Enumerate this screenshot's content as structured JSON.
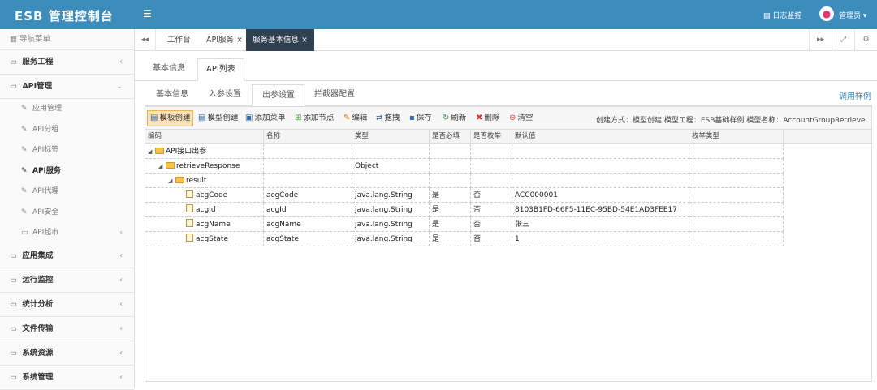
{
  "header": {
    "brand": "ESB 管理控制台",
    "log_link": "日志监控",
    "user": "管理员"
  },
  "sidebar": {
    "nav_title": "导航菜单",
    "menus": [
      {
        "label": "服务工程"
      },
      {
        "label": "API管理",
        "expanded": true
      },
      {
        "label": "应用集成"
      },
      {
        "label": "运行监控"
      },
      {
        "label": "统计分析"
      },
      {
        "label": "文件传输"
      },
      {
        "label": "系统资源"
      },
      {
        "label": "系统管理"
      }
    ],
    "api_items": [
      {
        "label": "应用管理"
      },
      {
        "label": "API分组"
      },
      {
        "label": "API标签"
      },
      {
        "label": "API服务",
        "active": true
      },
      {
        "label": "API代理"
      },
      {
        "label": "API安全"
      },
      {
        "label": "API超市"
      }
    ]
  },
  "page_tabs": [
    {
      "label": "工作台"
    },
    {
      "label": "API服务"
    },
    {
      "label": "服务基本信息",
      "active": true
    }
  ],
  "level1_tabs": [
    {
      "label": "基本信息"
    },
    {
      "label": "API列表",
      "active": true
    }
  ],
  "level2_tabs": [
    {
      "label": "基本信息"
    },
    {
      "label": "入参设置"
    },
    {
      "label": "出参设置",
      "active": true
    },
    {
      "label": "拦截器配置"
    }
  ],
  "side_link": "调用样例",
  "toolbar": {
    "buttons": [
      {
        "label": "模板创建",
        "icon": "grid-icon",
        "active": true
      },
      {
        "label": "模型创建",
        "icon": "grid-icon"
      },
      {
        "label": "添加菜单",
        "icon": "window-icon"
      },
      {
        "label": "添加节点",
        "icon": "add-file-icon"
      },
      {
        "label": "编辑",
        "icon": "pencil-icon"
      },
      {
        "label": "拖拽",
        "icon": "drag-icon"
      },
      {
        "label": "保存",
        "icon": "save-icon"
      },
      {
        "label": "刷新",
        "icon": "refresh-icon"
      },
      {
        "label": "删除",
        "icon": "delete-icon"
      },
      {
        "label": "清空",
        "icon": "clear-icon"
      }
    ],
    "info": "创建方式：模型创建   模型工程：ESB基础样例   模型名称：AccountGroupRetrieve"
  },
  "table": {
    "columns": [
      "编码",
      "名称",
      "类型",
      "是否必填",
      "是否枚举",
      "默认值",
      "枚举类型"
    ],
    "rows": [
      {
        "code": "API接口出参",
        "name": "",
        "type": "",
        "required": "",
        "enum": "",
        "default": "",
        "enum_type": ""
      },
      {
        "code": "retrieveResponse",
        "name": "",
        "type": "Object",
        "required": "",
        "enum": "",
        "default": "",
        "enum_type": ""
      },
      {
        "code": "result",
        "name": "",
        "type": "",
        "required": "",
        "enum": "",
        "default": "",
        "enum_type": ""
      },
      {
        "code": "acgCode",
        "name": "acgCode",
        "type": "java.lang.String",
        "required": "是",
        "enum": "否",
        "default": "ACC000001",
        "enum_type": ""
      },
      {
        "code": "acgId",
        "name": "acgId",
        "type": "java.lang.String",
        "required": "是",
        "enum": "否",
        "default": "8103B1FD-66F5-11EC-95BD-54E1AD3FEE17",
        "enum_type": ""
      },
      {
        "code": "acgName",
        "name": "acgName",
        "type": "java.lang.String",
        "required": "是",
        "enum": "否",
        "default": "张三",
        "enum_type": ""
      },
      {
        "code": "acgState",
        "name": "acgState",
        "type": "java.lang.String",
        "required": "是",
        "enum": "否",
        "default": "1",
        "enum_type": ""
      }
    ]
  }
}
